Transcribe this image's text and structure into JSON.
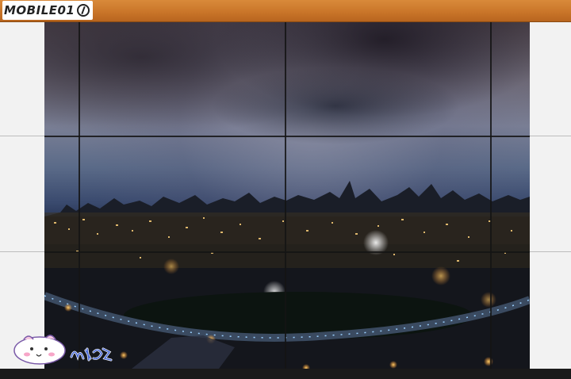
{
  "brand": {
    "logo_text": "MOBILE01"
  },
  "photo": {
    "subject": "",
    "tiles": {
      "columns": 3,
      "rows": 3
    }
  },
  "watermark": {
    "signature": "胡胡愛秀"
  },
  "colors": {
    "topbar": "#c87428",
    "wall": "#f2f2f2",
    "bezel": "#141414"
  }
}
